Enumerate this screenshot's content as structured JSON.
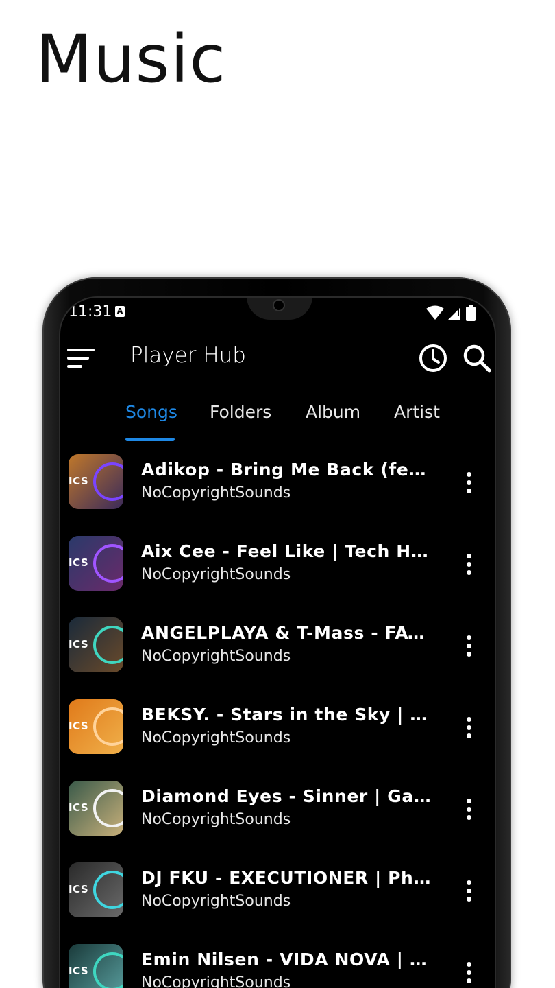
{
  "promo": {
    "title": "Music"
  },
  "status_bar": {
    "time": "11:31",
    "notification_icon": "a-icon"
  },
  "app_bar": {
    "title": "Player Hub",
    "icons": [
      "menu-icon",
      "history-icon",
      "search-icon"
    ]
  },
  "tabs": [
    {
      "label": "Songs",
      "active": true
    },
    {
      "label": "Folders",
      "active": false
    },
    {
      "label": "Album",
      "active": false
    },
    {
      "label": "Artist",
      "active": false
    }
  ],
  "accent_color": "#1e88e5",
  "songs": [
    {
      "title": "Adikop - Bring Me Back (feat. N...",
      "artist": "NoCopyrightSounds",
      "thumb_colors": [
        "#c0782a",
        "#3a2a5a"
      ],
      "ring_color": "#7a44ff",
      "logo": "ICS"
    },
    {
      "title": "Aix Cee - Feel Like | Tech Hous...",
      "artist": "NoCopyrightSounds",
      "thumb_colors": [
        "#2a3a6a",
        "#6a2a6a"
      ],
      "ring_color": "#a055ff",
      "logo": "ICS"
    },
    {
      "title": "ANGELPLAYA & T-Mass - FAVHE...",
      "artist": "NoCopyrightSounds",
      "thumb_colors": [
        "#1a2a3a",
        "#6a4a2a"
      ],
      "ring_color": "#3fd6c0",
      "logo": "ICS"
    },
    {
      "title": "BEKSY. - Stars in the Sky | Elec...",
      "artist": "NoCopyrightSounds",
      "thumb_colors": [
        "#e07a1a",
        "#f0b04a"
      ],
      "ring_color": "#ffd39a",
      "logo": "ICS"
    },
    {
      "title": "Diamond Eyes - Sinner | Garag...",
      "artist": "NoCopyrightSounds",
      "thumb_colors": [
        "#3a5a4a",
        "#c8b07a"
      ],
      "ring_color": "#f2f2f2",
      "logo": "ICS"
    },
    {
      "title": "DJ FKU - EXECUTIONER | Phonk...",
      "artist": "NoCopyrightSounds",
      "thumb_colors": [
        "#2a2a2a",
        "#6a6a6a"
      ],
      "ring_color": "#3fd6e0",
      "logo": "ICS"
    },
    {
      "title": "Emin Nilsen - VIDA NOVA | Bra...",
      "artist": "NoCopyrightSounds",
      "thumb_colors": [
        "#1a3a3a",
        "#5aa0a0"
      ],
      "ring_color": "#3fd6c0",
      "logo": "ICS"
    }
  ]
}
